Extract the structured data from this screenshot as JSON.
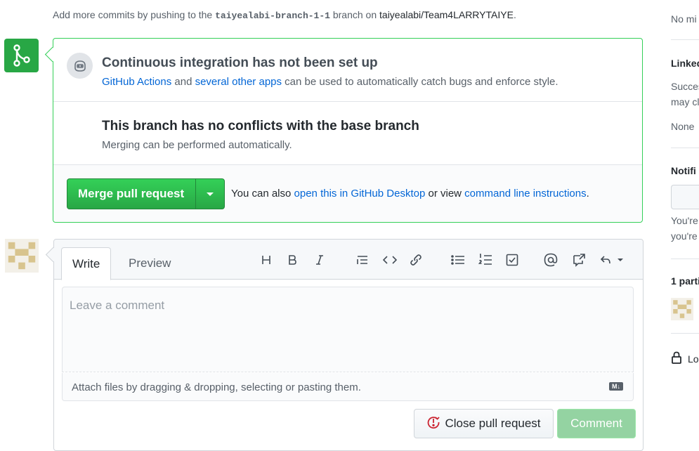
{
  "hint": {
    "prefix": "Add more commits by pushing to the",
    "branch": "taiyealabi-branch-1-1",
    "middle": "branch on",
    "repo": "taiyealabi/Team4LARRYTAIYE",
    "suffix": "."
  },
  "checks": {
    "ci": {
      "title": "Continuous integration has not been set up",
      "link1": "GitHub Actions",
      "and": "and",
      "link2": "several other apps",
      "rest": "can be used to automatically catch bugs and enforce style."
    },
    "conflicts": {
      "title": "This branch has no conflicts with the base branch",
      "subtitle": "Merging can be performed automatically."
    }
  },
  "merge": {
    "button_label": "Merge pull request",
    "also_prefix": "You can also",
    "desktop_link": "open this in GitHub Desktop",
    "or_view": "or view",
    "cli_link": "command line instructions",
    "period": "."
  },
  "comment": {
    "tabs": [
      "Write",
      "Preview"
    ],
    "placeholder": "Leave a comment",
    "attach_text": "Attach files by dragging & dropping, selecting or pasting them.",
    "markdown_badge": "M↓",
    "close_label": "Close pull request",
    "comment_label": "Comment"
  },
  "sidebar": {
    "milestone_value": "No mi",
    "linked_head": "Linked",
    "linked_desc1": "Succes",
    "linked_desc2": "may cl",
    "linked_value": "None",
    "notif_head": "Notifi",
    "notif_desc1": "You're",
    "notif_desc2": "you're",
    "participants": "1 parti",
    "lock_label": "Lo"
  },
  "colors": {
    "success": "#28a745",
    "link": "#0366d6",
    "border_green": "#34d058",
    "danger": "#cb2431"
  }
}
